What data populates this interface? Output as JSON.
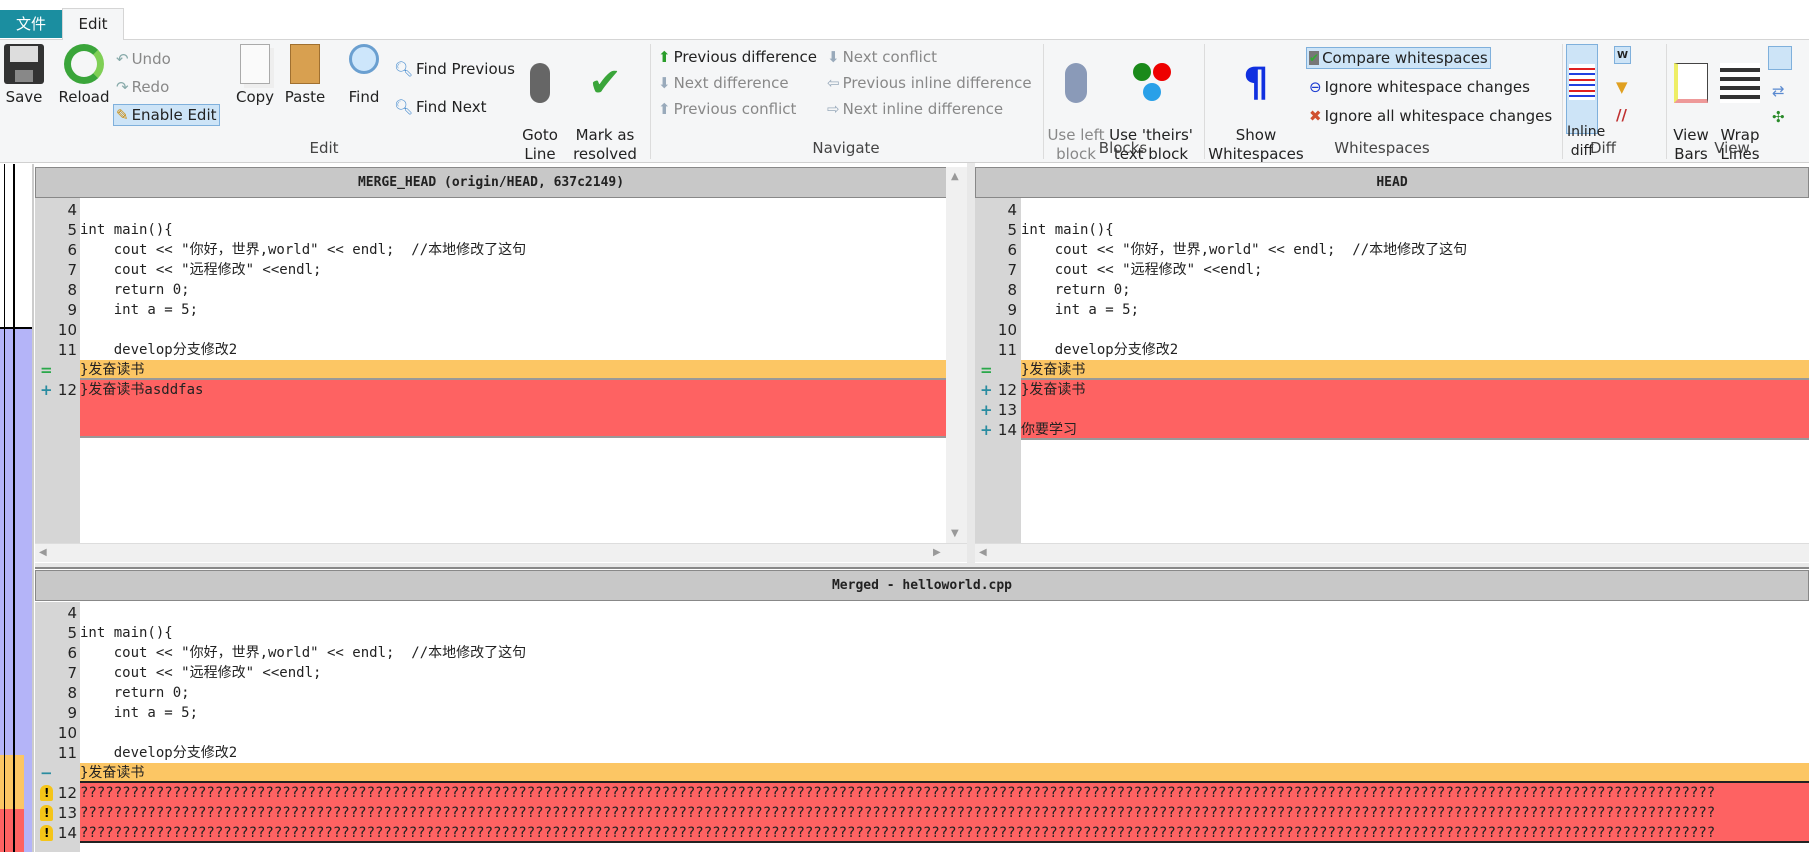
{
  "tabs": {
    "file": "文件",
    "edit": "Edit"
  },
  "ribbon": {
    "edit_group": {
      "label": "Edit",
      "save": "Save",
      "reload": "Reload",
      "undo": "Undo",
      "redo": "Redo",
      "enable_edit": "Enable Edit",
      "copy": "Copy",
      "paste": "Paste",
      "find": "Find",
      "find_previous": "Find Previous",
      "find_next": "Find Next",
      "goto_line": "Goto\nLine",
      "mark_resolved": "Mark as\nresolved"
    },
    "navigate_group": {
      "label": "Navigate",
      "previous_difference": "Previous difference",
      "next_difference": "Next difference",
      "previous_conflict": "Previous conflict",
      "next_conflict": "Next conflict",
      "previous_inline_difference": "Previous inline difference",
      "next_inline_difference": "Next inline difference"
    },
    "blocks_group": {
      "label": "Blocks",
      "use_left": "Use left\nblock",
      "use_theirs": "Use 'theirs'\ntext block"
    },
    "whitespaces_group": {
      "label": "Whitespaces",
      "show_whitespaces": "Show\nWhitespaces",
      "compare_whitespaces": "Compare whitespaces",
      "ignore_changes": "Ignore whitespace changes",
      "ignore_all": "Ignore all whitespace changes"
    },
    "diff_group": {
      "label": "Diff",
      "inline_diff": "Inline\ndiff"
    },
    "view_group": {
      "label": "View",
      "view_bars": "View\nBars",
      "wrap_lines": "Wrap\nLines"
    }
  },
  "panels": {
    "left": {
      "title": "MERGE_HEAD (origin/HEAD, 637c2149)",
      "added_line": "}发奋读书asddfas"
    },
    "right": {
      "title": "HEAD",
      "added_lines": [
        "}发奋读书",
        "",
        "你要学习"
      ]
    },
    "merged": {
      "title": "Merged - helloworld.cpp",
      "conflict_text": "??????????????????????????????????????????????????????????????????????????????????????????????????????????????????????????????????????????????????????????????????????????????????????????????????"
    }
  },
  "common_lines": [
    {
      "n": "4",
      "t": ""
    },
    {
      "n": "5",
      "t": "int main(){"
    },
    {
      "n": "6",
      "t": "    cout << \"你好，世界,world\" << endl;  //本地修改了这句"
    },
    {
      "n": "7",
      "t": "    cout << \"远程修改\" <<endl;"
    },
    {
      "n": "8",
      "t": "    return 0;"
    },
    {
      "n": "9",
      "t": "    int a = 5;"
    },
    {
      "n": "10",
      "t": ""
    },
    {
      "n": "11",
      "t": "    develop分支修改2"
    }
  ],
  "equal_line": "}发奋读书",
  "markers": {
    "equal": "=",
    "plus": "+",
    "minus": "−"
  },
  "line_numbers": {
    "n12": "12",
    "n13": "13",
    "n14": "14"
  },
  "colors": {
    "conflict": "#fe6262",
    "unchanged_context": "#fcc664",
    "accent": "#1b8ea0"
  }
}
